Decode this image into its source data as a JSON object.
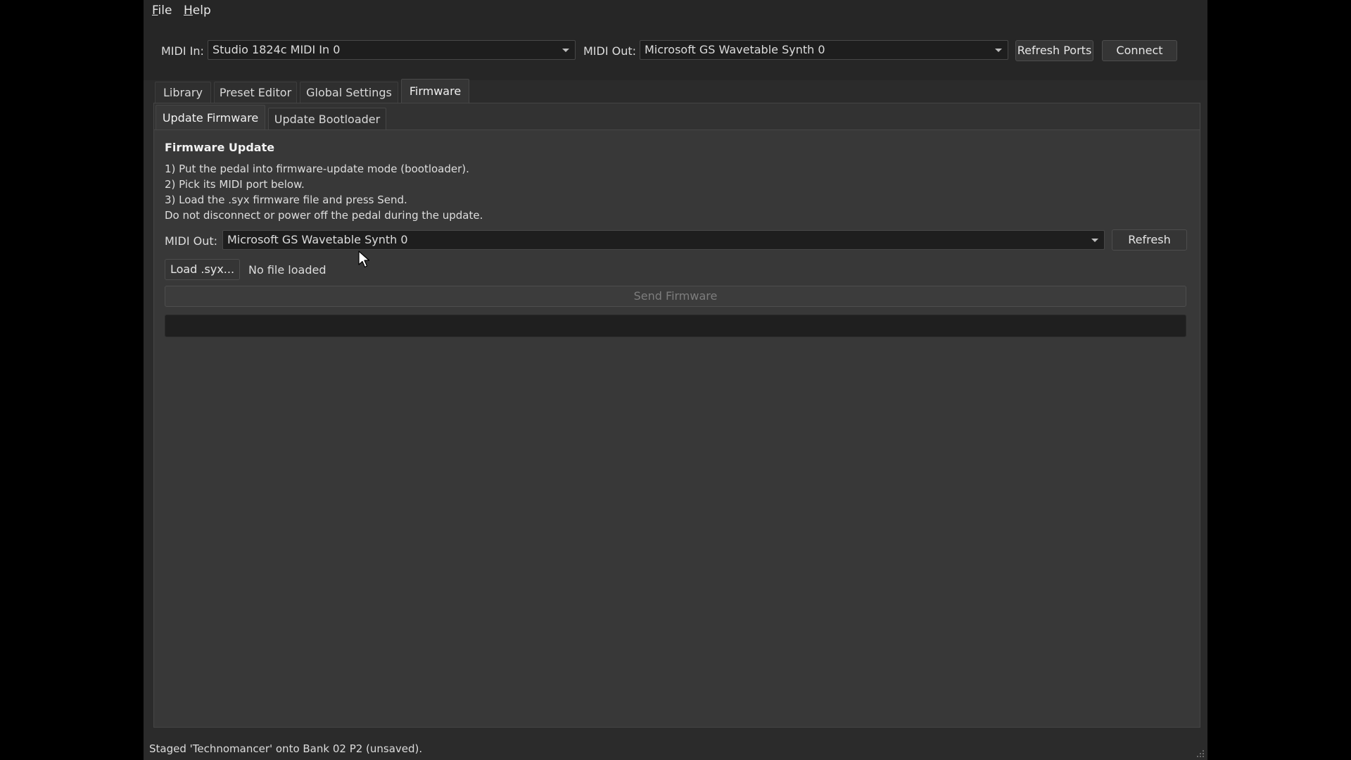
{
  "menu": {
    "file": {
      "accel": "F",
      "rest": "ile"
    },
    "help": {
      "accel": "H",
      "rest": "elp"
    }
  },
  "midi_bar": {
    "in_label": "MIDI In:",
    "in_value": "Studio 1824c MIDI In 0",
    "out_label": "MIDI Out:",
    "out_value": "Microsoft GS Wavetable Synth 0",
    "refresh_ports": "Refresh Ports",
    "connect": "Connect"
  },
  "tabs": [
    "Library",
    "Preset Editor",
    "Global Settings",
    "Firmware"
  ],
  "active_tab": "Firmware",
  "subtabs": [
    "Update Firmware",
    "Update Bootloader"
  ],
  "active_subtab": "Update Firmware",
  "firmware": {
    "heading": "Firmware Update",
    "instructions": [
      "1) Put the pedal into firmware-update mode (bootloader).",
      "2) Pick its MIDI port below.",
      "3) Load the .syx firmware file and press Send.",
      "Do not disconnect or power off the pedal during the update."
    ],
    "midi_out_label": "MIDI Out:",
    "midi_out_value": "Microsoft GS Wavetable Synth 0",
    "refresh": "Refresh",
    "load_button": "Load .syx...",
    "file_status": "No file loaded",
    "send_button": "Send Firmware",
    "progress": 0
  },
  "status_bar": "Staged 'Technomancer' onto Bank 02  P2 (unsaved).",
  "colors": {
    "background": "#2b2b2b",
    "panel": "#383838",
    "progress_track": "#1f1f1f",
    "disabled_text": "#7d7d7d"
  }
}
